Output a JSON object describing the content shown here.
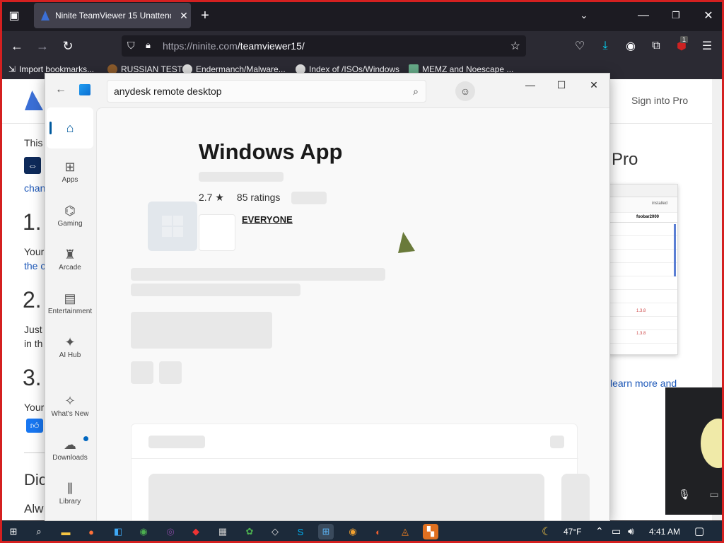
{
  "browser": {
    "tab_title": "Ninite TeamViewer 15 Unattend",
    "url_host": "https://ninite.com",
    "url_path": "/teamviewer15/",
    "bookmarks": [
      "Import bookmarks...",
      "RUSSIAN TEST",
      "Endermanch/Malware...",
      "Index of /ISOs/Windows",
      "MEMZ and Noescape ..."
    ],
    "downloads_badge": "1"
  },
  "webpage": {
    "sign_in": "Sign into Pro",
    "pro": "Pro",
    "frag_this": "This",
    "frag_chan": "chan",
    "step1": "1.",
    "frag_your1": "Your",
    "frag_the": "the c",
    "step2": "2.",
    "frag_just": "Just",
    "frag_inth": "in th",
    "step3": "3.",
    "frag_your2": "Your",
    "frag_dic": "Dic",
    "frag_alw": "Alw",
    "learn_more": "learn more and",
    "shot_installed": "installed",
    "shot_foobar": "foobar2000",
    "shot_ver1": "1.3.8",
    "shot_ver2": "1.3.8"
  },
  "store": {
    "search_value": "anydesk remote desktop",
    "rail": [
      {
        "label": "",
        "icon": "home-icon"
      },
      {
        "label": "Apps",
        "icon": "apps-icon"
      },
      {
        "label": "Gaming",
        "icon": "gaming-icon"
      },
      {
        "label": "Arcade",
        "icon": "arcade-icon"
      },
      {
        "label": "Entertainment",
        "icon": "entertainment-icon"
      },
      {
        "label": "AI Hub",
        "icon": "ai-hub-icon"
      },
      {
        "label": "What's New",
        "icon": "whats-new-icon"
      },
      {
        "label": "Downloads",
        "icon": "downloads-icon"
      },
      {
        "label": "Library",
        "icon": "library-icon"
      }
    ],
    "app_title": "Windows App",
    "rating_value": "2.7 ★",
    "rating_count": "85 ratings",
    "esrb": "EVERYONE"
  },
  "taskbar": {
    "temperature": "47°F",
    "time": "4:41 AM"
  },
  "colors": {
    "accent": "#005a9e",
    "frame": "#d42020",
    "link": "#1a56b8"
  }
}
